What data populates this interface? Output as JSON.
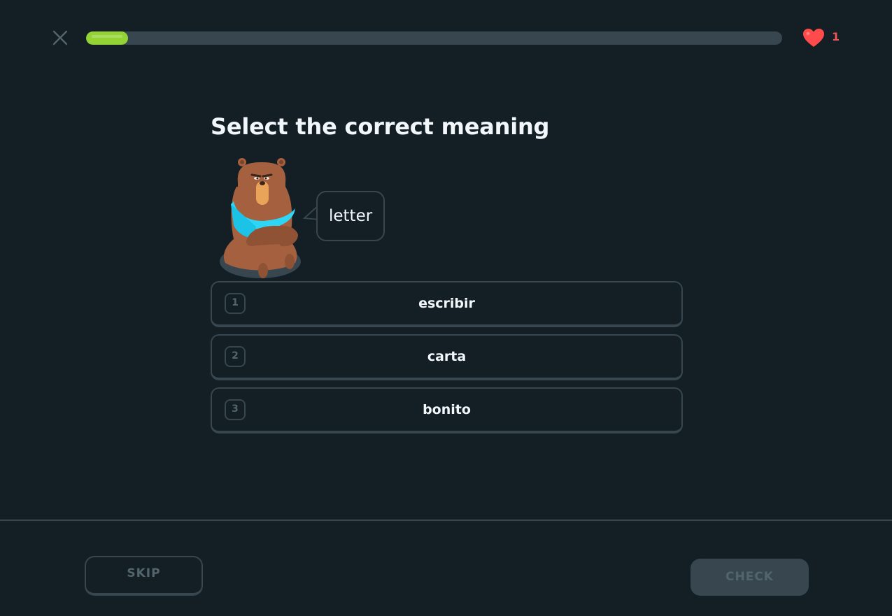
{
  "header": {
    "close_icon": "close-icon",
    "progress": 0.06,
    "progress_color": "#93d333",
    "hearts": {
      "icon": "heart-icon",
      "count": "1",
      "color": "#ee5555"
    }
  },
  "challenge": {
    "title": "Select the correct meaning",
    "character": "bear-character",
    "prompt_word": "letter",
    "options": [
      {
        "key": "1",
        "label": "escribir"
      },
      {
        "key": "2",
        "label": "carta"
      },
      {
        "key": "3",
        "label": "bonito"
      }
    ]
  },
  "footer": {
    "skip_label": "SKIP",
    "check_label": "CHECK"
  },
  "colors": {
    "background": "#131f24",
    "border": "#37464f",
    "muted_text": "#52656d",
    "text": "#f1f7fb"
  }
}
